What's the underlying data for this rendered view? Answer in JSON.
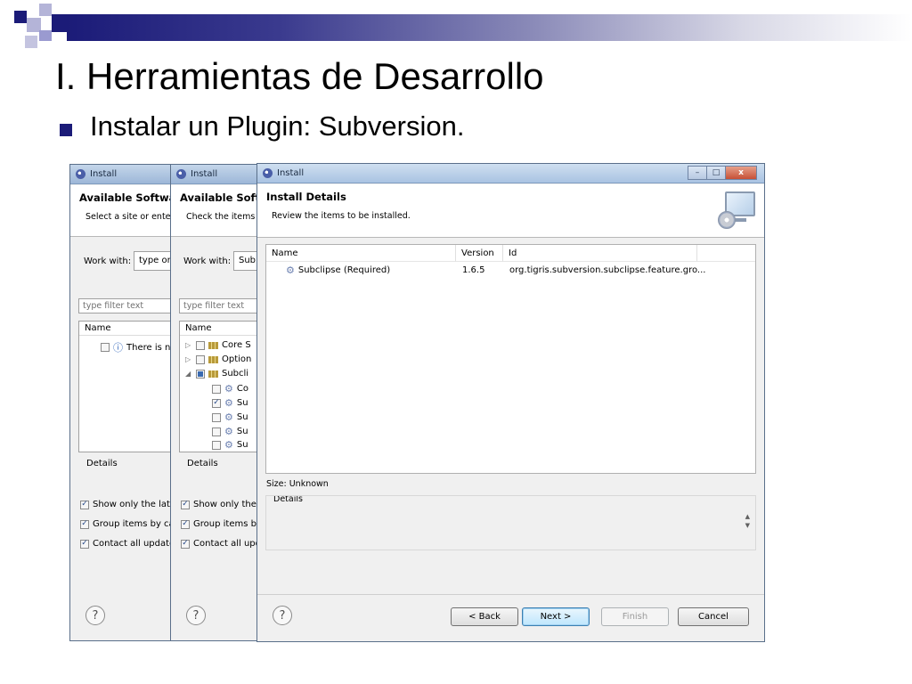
{
  "slide": {
    "title": "I. Herramientas de Desarrollo",
    "bullet": "Instalar un Plugin: Subversion.",
    "colors": {
      "accent": "#1b1b78",
      "accent_light": "#9a9ad0"
    }
  },
  "window1": {
    "title": "Install",
    "header_title": "Available Softwa",
    "header_sub": "Select a site or enter",
    "work_with_label": "Work with:",
    "work_with_value": "type or",
    "filter_placeholder": "type filter text",
    "tree_header": "Name",
    "tree_item": "There is n",
    "details_label": "Details",
    "options": [
      {
        "label": "Show only the late",
        "checked": true
      },
      {
        "label": "Group items by cat",
        "checked": true
      },
      {
        "label": "Contact all update",
        "checked": true
      }
    ],
    "help": "?"
  },
  "window2": {
    "title": "Install",
    "header_title": "Available Soft",
    "header_sub": "Check the items",
    "work_with_label": "Work with:",
    "work_with_value": "Sub",
    "filter_placeholder": "type filter text",
    "tree_header": "Name",
    "tree": [
      {
        "label": "Core S",
        "kind": "category",
        "expanded": false,
        "checked": "none"
      },
      {
        "label": "Option",
        "kind": "category",
        "expanded": false,
        "checked": "none"
      },
      {
        "label": "Subcli",
        "kind": "category",
        "expanded": true,
        "checked": "partial"
      },
      {
        "label": "Co",
        "kind": "feature",
        "checked": "none"
      },
      {
        "label": "Su",
        "kind": "feature",
        "checked": "checked"
      },
      {
        "label": "Su",
        "kind": "feature",
        "checked": "none"
      },
      {
        "label": "Su",
        "kind": "feature",
        "checked": "none"
      },
      {
        "label": "Su",
        "kind": "feature",
        "checked": "none"
      }
    ],
    "details_label": "Details",
    "options": [
      {
        "label": "Show only the l",
        "checked": true
      },
      {
        "label": "Group items by",
        "checked": true
      },
      {
        "label": "Contact all upd",
        "checked": true
      }
    ],
    "help": "?"
  },
  "window3": {
    "title": "Install",
    "header_title": "Install Details",
    "header_sub": "Review the items to be installed.",
    "columns": [
      "Name",
      "Version",
      "Id"
    ],
    "rows": [
      {
        "name": "Subclipse (Required)",
        "version": "1.6.5",
        "id": "org.tigris.subversion.subclipse.feature.gro..."
      }
    ],
    "size_label": "Size: Unknown",
    "details_label": "Details",
    "buttons": {
      "back": "< Back",
      "next": "Next >",
      "finish": "Finish",
      "cancel": "Cancel"
    },
    "controls": {
      "minimize": "–",
      "maximize": "□",
      "close": "x"
    },
    "help": "?"
  }
}
